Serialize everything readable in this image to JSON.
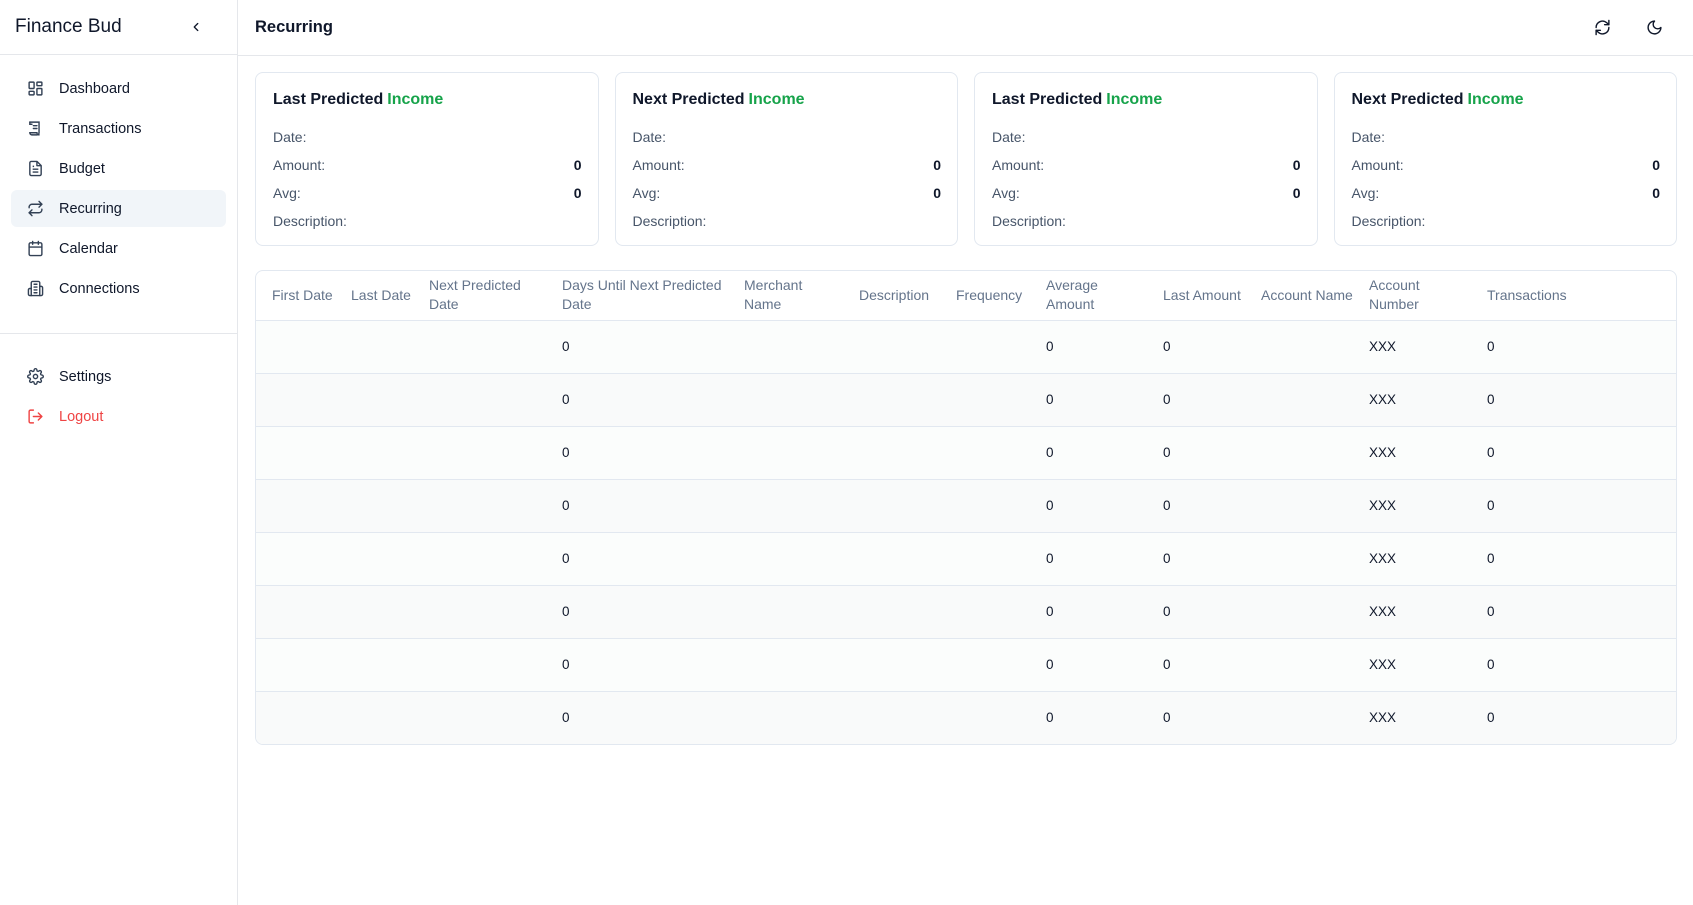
{
  "app": {
    "title": "Finance Bud"
  },
  "sidebar": {
    "items": [
      {
        "label": "Dashboard",
        "icon": "dashboard-icon"
      },
      {
        "label": "Transactions",
        "icon": "receipt-icon"
      },
      {
        "label": "Budget",
        "icon": "document-icon"
      },
      {
        "label": "Recurring",
        "icon": "repeat-icon",
        "active": true
      },
      {
        "label": "Calendar",
        "icon": "calendar-icon"
      },
      {
        "label": "Connections",
        "icon": "bank-icon"
      }
    ],
    "bottom_items": [
      {
        "label": "Settings",
        "icon": "gear-icon"
      },
      {
        "label": "Logout",
        "icon": "logout-icon"
      }
    ]
  },
  "header": {
    "title": "Recurring"
  },
  "cards": [
    {
      "prefix": "Last Predicted",
      "kind": "Income",
      "date_label": "Date:",
      "amount_label": "Amount:",
      "amount": "0",
      "avg_label": "Avg:",
      "avg": "0",
      "description_label": "Description:"
    },
    {
      "prefix": "Next Predicted",
      "kind": "Income",
      "date_label": "Date:",
      "amount_label": "Amount:",
      "amount": "0",
      "avg_label": "Avg:",
      "avg": "0",
      "description_label": "Description:"
    },
    {
      "prefix": "Last Predicted",
      "kind": "Income",
      "date_label": "Date:",
      "amount_label": "Amount:",
      "amount": "0",
      "avg_label": "Avg:",
      "avg": "0",
      "description_label": "Description:"
    },
    {
      "prefix": "Next Predicted",
      "kind": "Income",
      "date_label": "Date:",
      "amount_label": "Amount:",
      "amount": "0",
      "avg_label": "Avg:",
      "avg": "0",
      "description_label": "Description:"
    }
  ],
  "table": {
    "columns": [
      "First Date",
      "Last Date",
      "Next Predicted Date",
      "Days Until Next Predicted Date",
      "Merchant Name",
      "Description",
      "Frequency",
      "Average Amount",
      "Last Amount",
      "Account Name",
      "Account Number",
      "Transactions"
    ],
    "rows": [
      [
        "",
        "",
        "",
        "0",
        "",
        "",
        "",
        "0",
        "0",
        "",
        "XXX",
        "0"
      ],
      [
        "",
        "",
        "",
        "0",
        "",
        "",
        "",
        "0",
        "0",
        "",
        "XXX",
        "0"
      ],
      [
        "",
        "",
        "",
        "0",
        "",
        "",
        "",
        "0",
        "0",
        "",
        "XXX",
        "0"
      ],
      [
        "",
        "",
        "",
        "0",
        "",
        "",
        "",
        "0",
        "0",
        "",
        "XXX",
        "0"
      ],
      [
        "",
        "",
        "",
        "0",
        "",
        "",
        "",
        "0",
        "0",
        "",
        "XXX",
        "0"
      ],
      [
        "",
        "",
        "",
        "0",
        "",
        "",
        "",
        "0",
        "0",
        "",
        "XXX",
        "0"
      ],
      [
        "",
        "",
        "",
        "0",
        "",
        "",
        "",
        "0",
        "0",
        "",
        "XXX",
        "0"
      ],
      [
        "",
        "",
        "",
        "0",
        "",
        "",
        "",
        "0",
        "0",
        "",
        "XXX",
        "0"
      ]
    ]
  },
  "colors": {
    "accent": "#16a34a",
    "logout": "#ef4444",
    "active_bg": "#f1f5f9"
  }
}
